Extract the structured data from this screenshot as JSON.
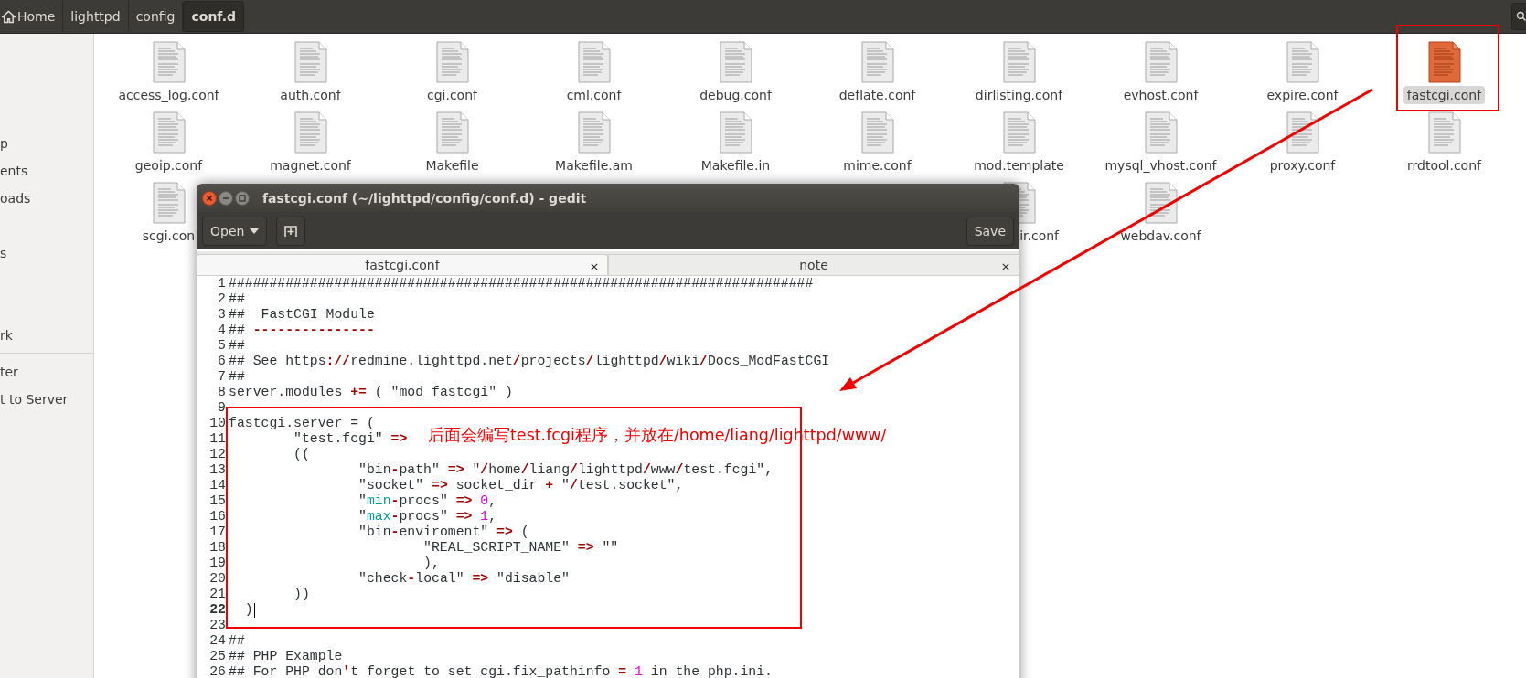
{
  "breadcrumbs": [
    {
      "label": "Home",
      "kind": "home",
      "selected": false
    },
    {
      "label": "lighttpd",
      "kind": "folder",
      "selected": false
    },
    {
      "label": "config",
      "kind": "folder",
      "selected": false
    },
    {
      "label": "conf.d",
      "kind": "folder",
      "selected": true
    }
  ],
  "sidebar": {
    "groups": [
      {
        "items": [
          {
            "label": "p"
          },
          {
            "label": "ents"
          },
          {
            "label": "oads"
          },
          {
            "label": "s"
          },
          {
            "label": "rk"
          }
        ]
      },
      {
        "items": [
          {
            "label": "ter"
          },
          {
            "label": "t to Server"
          }
        ]
      }
    ]
  },
  "files": {
    "rows": [
      [
        {
          "name": "access_log.conf",
          "selected": false
        },
        {
          "name": "auth.conf",
          "selected": false
        },
        {
          "name": "cgi.conf",
          "selected": false
        },
        {
          "name": "cml.conf",
          "selected": false
        },
        {
          "name": "debug.conf",
          "selected": false
        },
        {
          "name": "deflate.conf",
          "selected": false
        },
        {
          "name": "dirlisting.conf",
          "selected": false
        },
        {
          "name": "evhost.conf",
          "selected": false
        },
        {
          "name": "expire.conf",
          "selected": false
        },
        {
          "name": "fastcgi.conf",
          "selected": true
        }
      ],
      [
        {
          "name": "geoip.conf",
          "selected": false
        },
        {
          "name": "magnet.conf",
          "selected": false
        },
        {
          "name": "Makefile",
          "selected": false
        },
        {
          "name": "Makefile.am",
          "selected": false
        },
        {
          "name": "Makefile.in",
          "selected": false
        },
        {
          "name": "mime.conf",
          "selected": false
        },
        {
          "name": "mod.template",
          "selected": false
        },
        {
          "name": "mysql_vhost.conf",
          "selected": false
        },
        {
          "name": "proxy.conf",
          "selected": false
        },
        {
          "name": "rrdtool.conf",
          "selected": false
        }
      ],
      [
        {
          "name": "scgi.con",
          "selected": false
        },
        null,
        null,
        null,
        null,
        null,
        {
          "name": "ir.conf",
          "selected": false
        },
        {
          "name": "webdav.conf",
          "selected": false
        }
      ]
    ]
  },
  "editor": {
    "title": "fastcgi.conf (~/lighttpd/config/conf.d) - gedit",
    "toolbar": {
      "open": "Open",
      "save": "Save"
    },
    "tabs": [
      {
        "label": "fastcgi.conf",
        "selected": true
      },
      {
        "label": "note",
        "selected": false
      }
    ],
    "lines": [
      {
        "number": "1",
        "current": false,
        "segments": [
          {
            "text": "########################################################################",
            "kind": "plain"
          }
        ]
      },
      {
        "number": "2",
        "current": false,
        "segments": [
          {
            "text": "##",
            "kind": "plain"
          }
        ]
      },
      {
        "number": "3",
        "current": false,
        "segments": [
          {
            "text": "##  FastCGI Module",
            "kind": "plain"
          }
        ]
      },
      {
        "number": "4",
        "current": false,
        "segments": [
          {
            "text": "## ",
            "kind": "plain"
          },
          {
            "text": "---------------",
            "kind": "op"
          }
        ]
      },
      {
        "number": "5",
        "current": false,
        "segments": [
          {
            "text": "##",
            "kind": "plain"
          }
        ]
      },
      {
        "number": "6",
        "current": false,
        "segments": [
          {
            "text": "## See https",
            "kind": "plain"
          },
          {
            "text": "://",
            "kind": "op"
          },
          {
            "text": "redmine.lighttpd.net",
            "kind": "plain"
          },
          {
            "text": "/",
            "kind": "op"
          },
          {
            "text": "projects",
            "kind": "plain"
          },
          {
            "text": "/",
            "kind": "op"
          },
          {
            "text": "lighttpd",
            "kind": "plain"
          },
          {
            "text": "/",
            "kind": "op"
          },
          {
            "text": "wiki",
            "kind": "plain"
          },
          {
            "text": "/",
            "kind": "op"
          },
          {
            "text": "Docs_ModFastCGI",
            "kind": "plain"
          }
        ]
      },
      {
        "number": "7",
        "current": false,
        "segments": [
          {
            "text": "##",
            "kind": "plain"
          }
        ]
      },
      {
        "number": "8",
        "current": false,
        "segments": [
          {
            "text": "server.modules ",
            "kind": "plain"
          },
          {
            "text": "+=",
            "kind": "op"
          },
          {
            "text": " ( \"mod_fastcgi\" )",
            "kind": "plain"
          }
        ]
      },
      {
        "number": "9",
        "current": false
      },
      {
        "number": "10",
        "current": false,
        "segments": [
          {
            "text": "fastcgi.server = (",
            "kind": "plain"
          }
        ]
      },
      {
        "number": "11",
        "current": false,
        "segments": [
          {
            "text": "        \"test.fcgi\" ",
            "kind": "plain"
          },
          {
            "text": "=>",
            "kind": "op"
          }
        ]
      },
      {
        "number": "12",
        "current": false,
        "segments": [
          {
            "text": "        ((",
            "kind": "plain"
          }
        ]
      },
      {
        "number": "13",
        "current": false,
        "segments": [
          {
            "text": "                \"bin",
            "kind": "plain"
          },
          {
            "text": "-",
            "kind": "op"
          },
          {
            "text": "path\" ",
            "kind": "plain"
          },
          {
            "text": "=>",
            "kind": "op"
          },
          {
            "text": " \"",
            "kind": "plain"
          },
          {
            "text": "/",
            "kind": "op"
          },
          {
            "text": "home",
            "kind": "plain"
          },
          {
            "text": "/",
            "kind": "op"
          },
          {
            "text": "liang",
            "kind": "plain"
          },
          {
            "text": "/",
            "kind": "op"
          },
          {
            "text": "lighttpd",
            "kind": "plain"
          },
          {
            "text": "/",
            "kind": "op"
          },
          {
            "text": "www",
            "kind": "plain"
          },
          {
            "text": "/",
            "kind": "op"
          },
          {
            "text": "test.fcgi\",",
            "kind": "plain"
          }
        ]
      },
      {
        "number": "14",
        "current": false,
        "segments": [
          {
            "text": "                \"socket\" ",
            "kind": "plain"
          },
          {
            "text": "=>",
            "kind": "op"
          },
          {
            "text": " socket_dir ",
            "kind": "plain"
          },
          {
            "text": "+",
            "kind": "op"
          },
          {
            "text": " \"",
            "kind": "plain"
          },
          {
            "text": "/",
            "kind": "op"
          },
          {
            "text": "test.socket\",",
            "kind": "plain"
          }
        ]
      },
      {
        "number": "15",
        "current": false,
        "segments": [
          {
            "text": "                \"",
            "kind": "plain"
          },
          {
            "text": "min",
            "kind": "keyword"
          },
          {
            "text": "-",
            "kind": "op"
          },
          {
            "text": "procs\" ",
            "kind": "plain"
          },
          {
            "text": "=> ",
            "kind": "op"
          },
          {
            "text": "0",
            "kind": "number"
          },
          {
            "text": ",",
            "kind": "plain"
          }
        ]
      },
      {
        "number": "16",
        "current": false,
        "segments": [
          {
            "text": "                \"",
            "kind": "plain"
          },
          {
            "text": "max",
            "kind": "keyword"
          },
          {
            "text": "-",
            "kind": "op"
          },
          {
            "text": "procs\" ",
            "kind": "plain"
          },
          {
            "text": "=> ",
            "kind": "op"
          },
          {
            "text": "1",
            "kind": "number"
          },
          {
            "text": ",",
            "kind": "plain"
          }
        ]
      },
      {
        "number": "17",
        "current": false,
        "segments": [
          {
            "text": "                \"bin",
            "kind": "plain"
          },
          {
            "text": "-",
            "kind": "op"
          },
          {
            "text": "enviroment\" ",
            "kind": "plain"
          },
          {
            "text": "=>",
            "kind": "op"
          },
          {
            "text": " (",
            "kind": "plain"
          }
        ]
      },
      {
        "number": "18",
        "current": false,
        "segments": [
          {
            "text": "                        \"REAL_SCRIPT_NAME\" ",
            "kind": "plain"
          },
          {
            "text": "=>",
            "kind": "op"
          },
          {
            "text": " \"\"",
            "kind": "plain"
          }
        ]
      },
      {
        "number": "19",
        "current": false,
        "segments": [
          {
            "text": "                        ),",
            "kind": "plain"
          }
        ]
      },
      {
        "number": "20",
        "current": false,
        "segments": [
          {
            "text": "                \"check",
            "kind": "plain"
          },
          {
            "text": "-",
            "kind": "op"
          },
          {
            "text": "local\" ",
            "kind": "plain"
          },
          {
            "text": "=>",
            "kind": "op"
          },
          {
            "text": " \"disable\"",
            "kind": "plain"
          }
        ]
      },
      {
        "number": "21",
        "current": false,
        "segments": [
          {
            "text": "        ))",
            "kind": "plain"
          }
        ]
      },
      {
        "number": "22",
        "current": true,
        "segments": [
          {
            "text": "  )",
            "kind": "plain"
          }
        ]
      },
      {
        "number": "23",
        "current": false
      },
      {
        "number": "24",
        "current": false,
        "segments": [
          {
            "text": "##",
            "kind": "plain"
          }
        ]
      },
      {
        "number": "25",
        "current": false,
        "segments": [
          {
            "text": "## PHP Example",
            "kind": "plain"
          }
        ]
      },
      {
        "number": "26",
        "current": false,
        "segments": [
          {
            "text": "## For PHP don",
            "kind": "plain"
          },
          {
            "text": "'",
            "kind": "op"
          },
          {
            "text": "t forget to set cgi.fix_pathinfo ",
            "kind": "plain"
          },
          {
            "text": "= ",
            "kind": "op"
          },
          {
            "text": "1",
            "kind": "number"
          },
          {
            "text": " in the php.ini.",
            "kind": "plain"
          }
        ]
      }
    ]
  },
  "annotation": {
    "note": "后面会编写test.fcgi程序，并放在/home/liang/lighttpd/www/"
  }
}
